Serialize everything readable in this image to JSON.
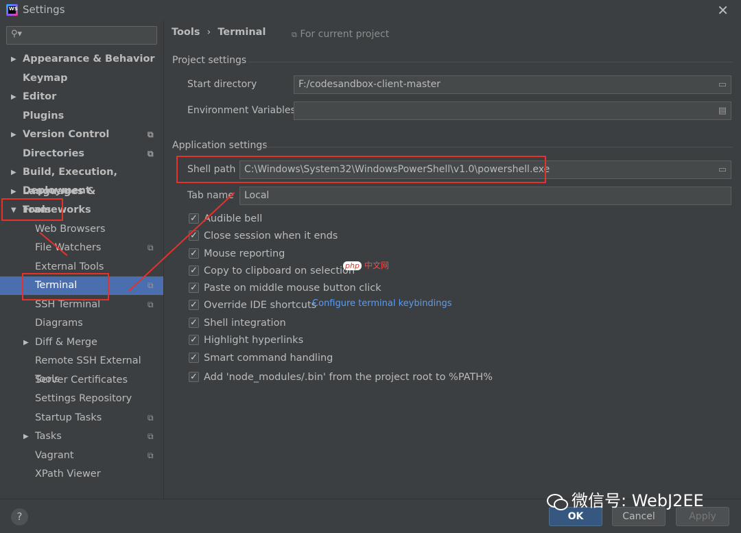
{
  "window": {
    "title": "Settings",
    "close": "✕",
    "app_icon_text": "WS"
  },
  "sidebar": {
    "search_placeholder": "",
    "items": [
      {
        "label": "Appearance & Behavior",
        "arrow": "▶",
        "bold": true,
        "level": 0,
        "project": false
      },
      {
        "label": "Keymap",
        "arrow": "",
        "bold": true,
        "level": 0,
        "project": false
      },
      {
        "label": "Editor",
        "arrow": "▶",
        "bold": true,
        "level": 0,
        "project": false
      },
      {
        "label": "Plugins",
        "arrow": "",
        "bold": true,
        "level": 0,
        "project": false
      },
      {
        "label": "Version Control",
        "arrow": "▶",
        "bold": true,
        "level": 0,
        "project": true
      },
      {
        "label": "Directories",
        "arrow": "",
        "bold": true,
        "level": 0,
        "project": true
      },
      {
        "label": "Build, Execution, Deployment",
        "arrow": "▶",
        "bold": true,
        "level": 0,
        "project": false
      },
      {
        "label": "Languages & Frameworks",
        "arrow": "▶",
        "bold": true,
        "level": 0,
        "project": false
      },
      {
        "label": "Tools",
        "arrow": "▼",
        "bold": true,
        "level": 0,
        "project": false
      },
      {
        "label": "Web Browsers",
        "arrow": "",
        "bold": false,
        "level": 1,
        "project": false
      },
      {
        "label": "File Watchers",
        "arrow": "",
        "bold": false,
        "level": 1,
        "project": true
      },
      {
        "label": "External Tools",
        "arrow": "",
        "bold": false,
        "level": 1,
        "project": false
      },
      {
        "label": "Terminal",
        "arrow": "",
        "bold": false,
        "level": 1,
        "project": true,
        "selected": true
      },
      {
        "label": "SSH Terminal",
        "arrow": "",
        "bold": false,
        "level": 1,
        "project": true
      },
      {
        "label": "Diagrams",
        "arrow": "",
        "bold": false,
        "level": 1,
        "project": false
      },
      {
        "label": "Diff & Merge",
        "arrow": "▶",
        "bold": false,
        "level": 1,
        "project": false
      },
      {
        "label": "Remote SSH External Tools",
        "arrow": "",
        "bold": false,
        "level": 1,
        "project": false
      },
      {
        "label": "Server Certificates",
        "arrow": "",
        "bold": false,
        "level": 1,
        "project": false
      },
      {
        "label": "Settings Repository",
        "arrow": "",
        "bold": false,
        "level": 1,
        "project": false
      },
      {
        "label": "Startup Tasks",
        "arrow": "",
        "bold": false,
        "level": 1,
        "project": true
      },
      {
        "label": "Tasks",
        "arrow": "▶",
        "bold": false,
        "level": 1,
        "project": true
      },
      {
        "label": "Vagrant",
        "arrow": "",
        "bold": false,
        "level": 1,
        "project": true
      },
      {
        "label": "XPath Viewer",
        "arrow": "",
        "bold": false,
        "level": 1,
        "project": false
      }
    ]
  },
  "main": {
    "breadcrumb": {
      "parent": "Tools",
      "separator": "›",
      "current": "Terminal"
    },
    "for_current_project": "For current project",
    "project_settings": {
      "title": "Project settings",
      "start_directory_label": "Start directory",
      "start_directory_value": "F:/codesandbox-client-master",
      "env_vars_label": "Environment Variables",
      "env_vars_value": ""
    },
    "application_settings": {
      "title": "Application settings",
      "shell_path_label": "Shell path",
      "shell_path_value": "C:\\Windows\\System32\\WindowsPowerShell\\v1.0\\powershell.exe",
      "tab_name_label": "Tab name",
      "tab_name_value": "Local"
    },
    "checkboxes": [
      {
        "label": "Audible bell",
        "checked": true
      },
      {
        "label": "Close session when it ends",
        "checked": true
      },
      {
        "label": "Mouse reporting",
        "checked": true
      },
      {
        "label": "Copy to clipboard on selection",
        "checked": true
      },
      {
        "label": "Paste on middle mouse button click",
        "checked": true
      },
      {
        "label": "Override IDE shortcuts",
        "checked": true
      },
      {
        "label": "Shell integration",
        "checked": true
      },
      {
        "label": "Highlight hyperlinks",
        "checked": true
      },
      {
        "label": "Smart command handling",
        "checked": true
      },
      {
        "label": "Add 'node_modules/.bin' from the project root to %PATH%",
        "checked": true
      }
    ],
    "configure_keybindings_link": "Configure terminal keybindings"
  },
  "footer": {
    "help": "?",
    "ok": "OK",
    "cancel": "Cancel",
    "apply": "Apply"
  },
  "overlays": {
    "php_badge": "php",
    "php_text": "中文网",
    "watermark": "微信号: WebJ2EE"
  },
  "colors": {
    "background": "#3c3f41",
    "selection": "#4b6eaf",
    "link": "#589df6",
    "annotation": "#e8302c"
  }
}
